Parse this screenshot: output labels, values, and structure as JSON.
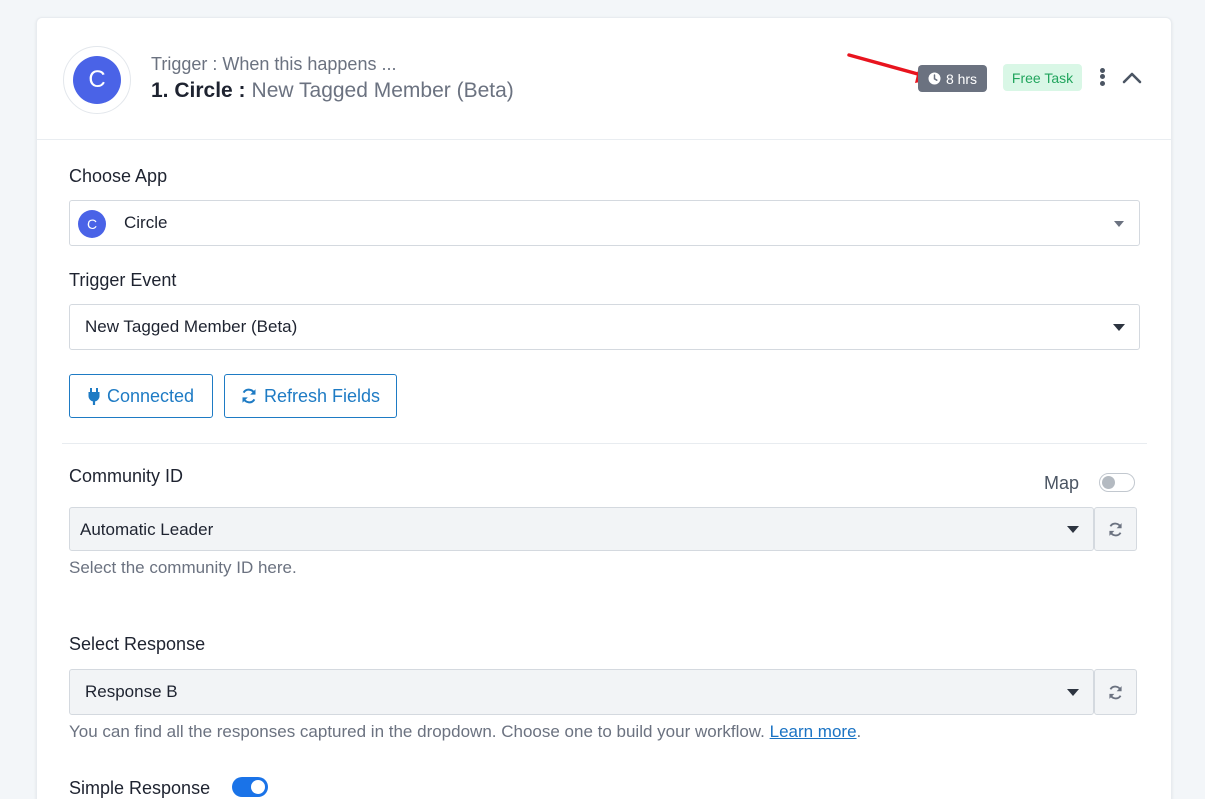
{
  "header": {
    "trigger_label": "Trigger : When this happens ...",
    "step_prefix": "1. Circle :",
    "step_event": "New Tagged Member (Beta)",
    "logo_letter": "C",
    "time_badge": "8 hrs",
    "free_badge": "Free Task"
  },
  "choose_app": {
    "label": "Choose App",
    "value": "Circle",
    "logo_letter": "C"
  },
  "trigger_event": {
    "label": "Trigger Event",
    "value": "New Tagged Member (Beta)"
  },
  "buttons": {
    "connected": "Connected",
    "refresh_fields": "Refresh Fields"
  },
  "community": {
    "label": "Community ID",
    "map_label": "Map",
    "map_on": false,
    "value": "Automatic Leader",
    "help": "Select the community ID here."
  },
  "response": {
    "label": "Select Response",
    "value": "Response B",
    "help_prefix": "You can find all the responses captured in the dropdown. Choose one to build your workflow.",
    "learn_more": "Learn more",
    "help_suffix": "."
  },
  "simple_response": {
    "label": "Simple Response",
    "on": true
  },
  "colors": {
    "brand": "#4a63e7",
    "link": "#1e7bc4",
    "annotation_arrow": "#e8141e"
  }
}
